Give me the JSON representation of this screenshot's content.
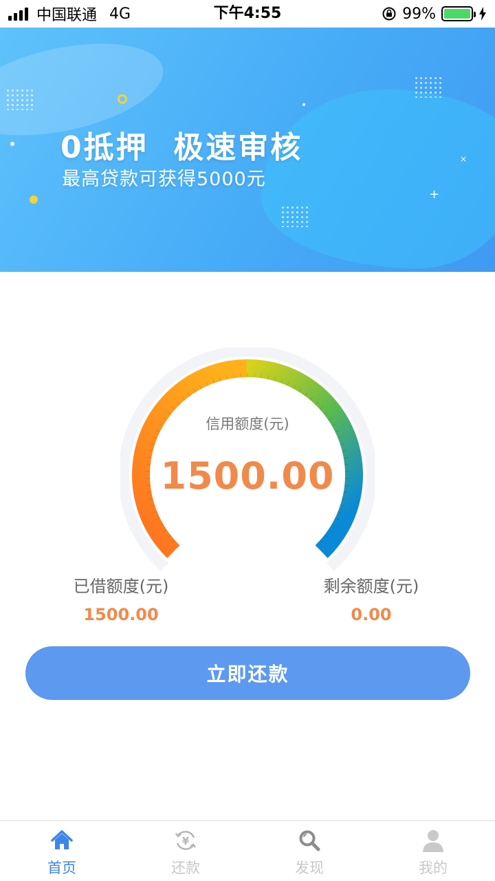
{
  "status_bar": {
    "carrier": "中国联通",
    "network": "4G",
    "time": "下午4:55",
    "battery": "99%",
    "battery_level": 0.99
  },
  "banner": {
    "title": "0抵押  极速审核",
    "subtitle": "最高贷款可获得5000元"
  },
  "credit": {
    "label": "信用额度(元)",
    "value": "1500.00"
  },
  "stats": {
    "borrowed_label": "已借额度(元)",
    "borrowed_value": "1500.00",
    "remaining_label": "剩余额度(元)",
    "remaining_value": "0.00"
  },
  "actions": {
    "repay_label": "立即还款"
  },
  "tabs": [
    {
      "label": "首页",
      "icon": "home-icon",
      "active": true
    },
    {
      "label": "还款",
      "icon": "repay-icon",
      "active": false
    },
    {
      "label": "发现",
      "icon": "search-icon",
      "active": false
    },
    {
      "label": "我的",
      "icon": "user-icon",
      "active": false
    }
  ],
  "colors": {
    "accent": "#5d99ee",
    "amount": "#f08a4b",
    "tab_active": "#3d86e8",
    "tab_inactive": "#c8c8c8"
  }
}
